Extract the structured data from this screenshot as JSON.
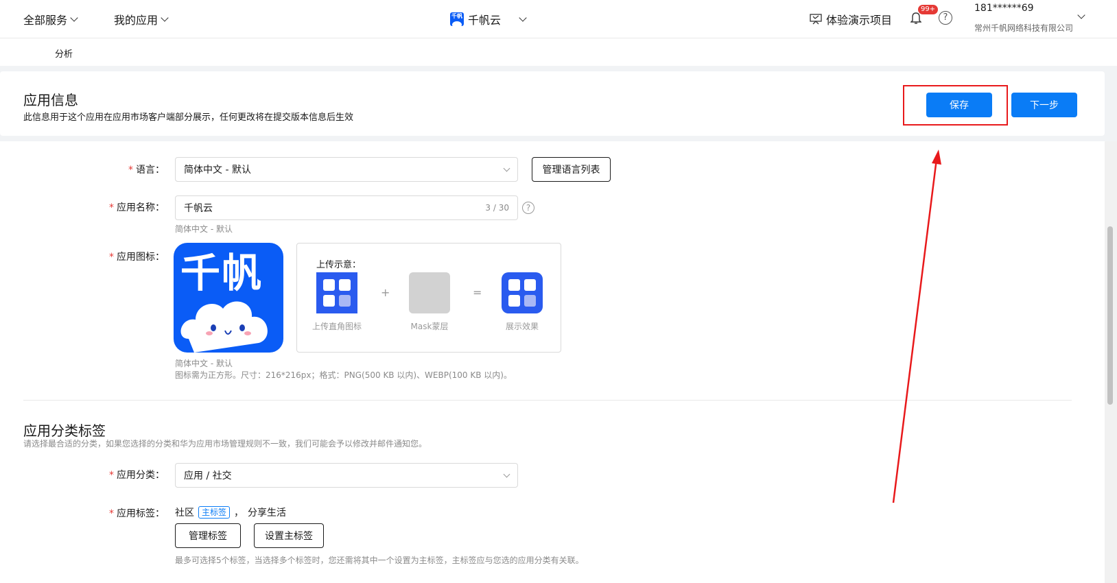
{
  "topbar": {
    "all_services": "全部服务",
    "my_apps": "我的应用",
    "app_name": "千帆云",
    "app_logo_text": "千帆",
    "demo_project": "体验演示项目",
    "notif_badge": "99+",
    "help_glyph": "?",
    "account_phone": "181******69",
    "account_company": "常州千帆网络科技有限公司"
  },
  "subnav": {
    "tab": "分析"
  },
  "header": {
    "title": "应用信息",
    "desc": "此信息用于这个应用在应用市场客户端部分展示，任何更改将在提交版本信息后生效",
    "save": "保存",
    "next": "下一步"
  },
  "form": {
    "language": {
      "label": "语言：",
      "value": "简体中文 - 默认",
      "manage_button": "管理语言列表"
    },
    "app_name": {
      "label": "应用名称：",
      "value": "千帆云",
      "counter": "3 / 30",
      "hint": "简体中文 - 默认"
    },
    "app_icon": {
      "label": "应用图标：",
      "icon_text": "千帆",
      "hint_lang": "简体中文 - 默认",
      "hint_spec": "图标需为正方形。尺寸：216*216px；格式：PNG(500 KB 以内)、WEBP(100 KB 以内)。",
      "sample_title": "上传示意：",
      "sample_plus": "+",
      "sample_equals": "=",
      "sample_cap_1": "上传直角图标",
      "sample_cap_2": "Mask蒙层",
      "sample_cap_3": "展示效果"
    }
  },
  "category_section": {
    "title": "应用分类标签",
    "desc": "请选择最合适的分类，如果您选择的分类和华为应用市场管理规则不一致，我们可能会予以修改并邮件通知您。",
    "category": {
      "label": "应用分类：",
      "value": "应用 / 社交"
    },
    "tags": {
      "label": "应用标签：",
      "tag1": "社区",
      "main_tag_badge": "主标签",
      "separator": "，",
      "tag2": "分享生活",
      "manage_button": "管理标签",
      "set_main_button": "设置主标签",
      "hint": "最多可选择5个标签，当选择多个标签时，您还需将其中一个设置为主标签，主标签应与您选的应用分类有关联。"
    }
  },
  "colors": {
    "primary": "#0a7cf6",
    "brand": "#0a5cf6",
    "highlight": "#e8191b"
  }
}
